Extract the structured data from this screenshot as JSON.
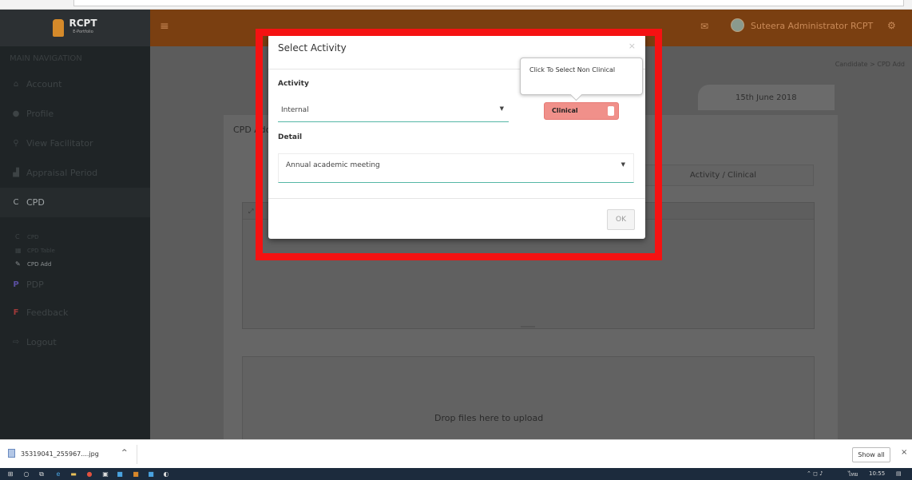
{
  "brand": {
    "name": "RCPT",
    "sub": "E-Portfolio"
  },
  "sidebar": {
    "heading": "MAIN NAVIGATION",
    "items": [
      {
        "label": "Account",
        "icon": "home-icon"
      },
      {
        "label": "Profile",
        "icon": "user-icon"
      },
      {
        "label": "View Facilitator",
        "icon": "search-icon"
      },
      {
        "label": "Appraisal Period",
        "icon": "chart-icon"
      },
      {
        "label": "CPD",
        "icon": "c-icon"
      }
    ],
    "sub_items": [
      {
        "label": "CPD",
        "icon": "c-icon"
      },
      {
        "label": "CPD Table",
        "icon": "table-icon"
      },
      {
        "label": "CPD Add",
        "icon": "pencil-icon"
      }
    ],
    "more_items": [
      {
        "label": "PDP",
        "icon": "p-icon"
      },
      {
        "label": "Feedback",
        "icon": "f-icon"
      },
      {
        "label": "Logout",
        "icon": "logout-icon"
      }
    ]
  },
  "header": {
    "user_name": "Suteera Administrator RCPT",
    "menu_icon": "hamburger-icon",
    "mail_icon": "mail-icon",
    "settings_icon": "gears-icon"
  },
  "breadcrumb": {
    "parent": "Candidate",
    "separator": ">",
    "current": "CPD Add"
  },
  "date": "15th June 2018",
  "panel": {
    "title": "CPD Add",
    "tab_clinical": "Activity / Clinical",
    "dropzone": "Drop files here to upload"
  },
  "modal": {
    "title": "Select Activity",
    "close": "×",
    "activity_label": "Activity",
    "activity_value": "Internal",
    "toggle_label": "Clinical",
    "tooltip": "Click To Select Non Clinical",
    "detail_label": "Detail",
    "detail_value": "Annual academic meeting",
    "ok": "OK"
  },
  "download_bar": {
    "file_name": "35319041_255967....jpg",
    "show_all": "Show all",
    "close": "×"
  },
  "taskbar": {
    "time": "10:55",
    "lang": "ไทย"
  },
  "colors": {
    "header": "#7a3f11",
    "sidebar": "#1f2426",
    "highlight": "#f51212",
    "toggle": "#f0908a",
    "accent": "#55b7a6"
  }
}
